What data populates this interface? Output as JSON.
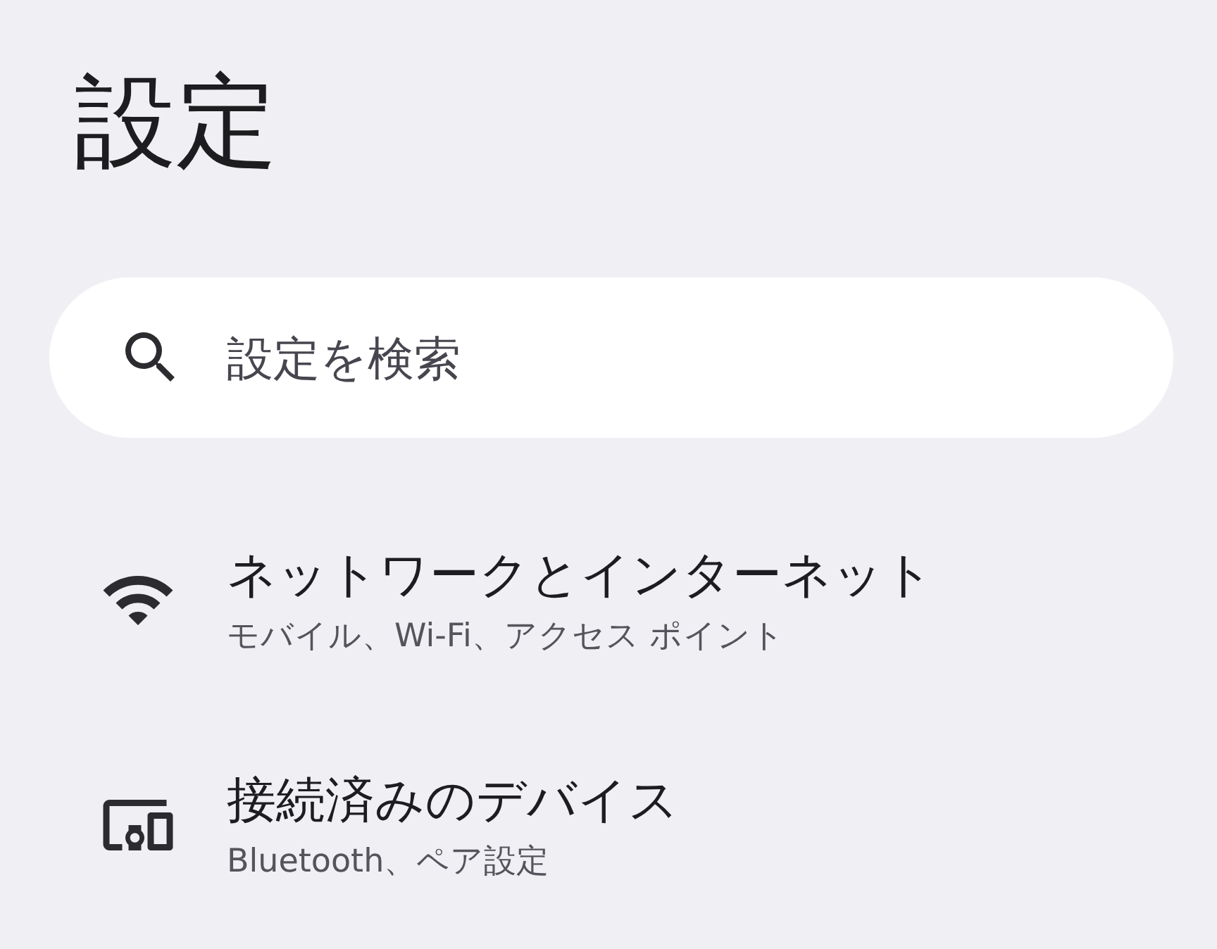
{
  "title": "設定",
  "search": {
    "placeholder": "設定を検索"
  },
  "items": [
    {
      "kind": "network",
      "title": "ネットワークとインターネット",
      "subtitle": "モバイル、Wi-Fi、アクセス ポイント"
    },
    {
      "kind": "devices",
      "title": "接続済みのデバイス",
      "subtitle": "Bluetooth、ペア設定"
    }
  ]
}
